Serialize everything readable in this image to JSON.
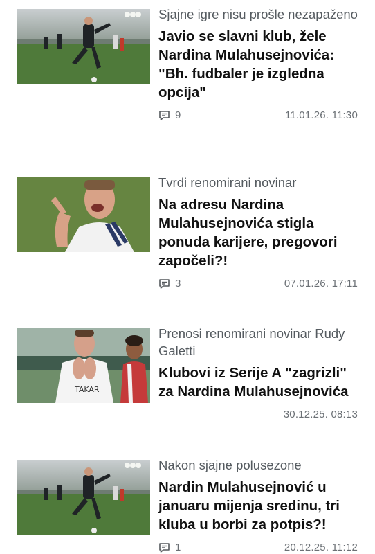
{
  "articles": [
    {
      "kicker": "Sjajne igre nisu prošle nezapaženo",
      "title": "Javio se slavni klub, žele Nardina Mulahusejnovića: \"Bh. fudbaler je izgledna opcija\"",
      "comments": "9",
      "date": "11.01.26. 11:30",
      "image": "football-match-stadium-photo"
    },
    {
      "kicker": "Tvrdi renomirani novinar",
      "title": "Na adresu Nardina Mulahusejnovića stigla ponuda karijere, pregovori započeli?!",
      "comments": "3",
      "date": "07.01.26. 17:11",
      "image": "player-celebrating-photo"
    },
    {
      "kicker": "Prenosi renomirani novinar Rudy Galetti",
      "title": "Klubovi iz Serije A \"zagrizli\" za Nardina Mulahusejnovića",
      "comments": "",
      "date": "30.12.25. 08:13",
      "image": "players-clapping-photo"
    },
    {
      "kicker": "Nakon sjajne polusezone",
      "title": "Nardin Mulahusejnović u januaru mijenja sredinu, tri kluba u borbi za potpis?!",
      "comments": "1",
      "date": "20.12.25. 11:12",
      "image": "football-match-stadium-photo"
    }
  ],
  "icons": {
    "comment": "comment-icon"
  },
  "colors": {
    "title": "#111111",
    "kicker": "#555b60",
    "meta": "#6b7075"
  }
}
